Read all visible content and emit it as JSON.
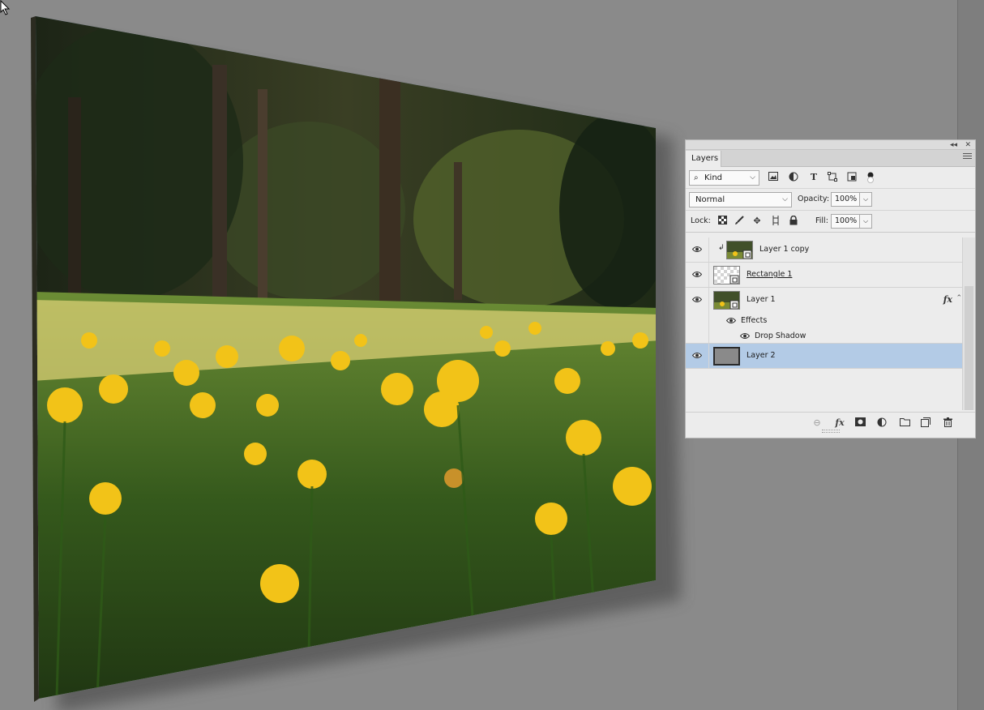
{
  "layers_panel": {
    "tab_label": "Layers",
    "filter": {
      "kind_label": "Kind"
    },
    "blend_mode": "Normal",
    "opacity_label": "Opacity:",
    "opacity_value": "100%",
    "lock_label": "Lock:",
    "fill_label": "Fill:",
    "fill_value": "100%",
    "layers": [
      {
        "name": "Layer 1 copy",
        "visible": true,
        "clipped": true,
        "thumbnail": "photo-smart-object"
      },
      {
        "name": "Rectangle 1",
        "visible": true,
        "thumbnail": "transparent-smart-object"
      },
      {
        "name": "Layer 1",
        "visible": true,
        "thumbnail": "photo-smart-object",
        "fx_label": "fx",
        "effects_label": "Effects",
        "effects": [
          {
            "name": "Drop Shadow",
            "visible": true
          }
        ]
      },
      {
        "name": "Layer 2",
        "visible": true,
        "selected": true,
        "thumbnail": "gray-fill"
      }
    ]
  },
  "colors": {
    "workspace": "#8a8a8a",
    "panel_bg": "#ececec",
    "selected_row": "#b3cbe6",
    "daffodil_yellow": "#f2c318",
    "grass_green": "#3f6a1e"
  },
  "icons": {
    "filter": [
      "search-icon",
      "image-filter-icon",
      "adjustment-filter-icon",
      "type-filter-icon",
      "shape-filter-icon",
      "smart-object-filter-icon",
      "filter-toggle-icon"
    ],
    "lock": [
      "lock-transparent-pixels-icon",
      "lock-image-pixels-icon",
      "lock-position-icon",
      "lock-artboard-icon",
      "lock-all-icon"
    ],
    "bottom": [
      "link-layers-icon",
      "add-style-icon",
      "add-mask-icon",
      "new-adjustment-icon",
      "new-group-icon",
      "new-layer-icon",
      "delete-layer-icon"
    ]
  }
}
